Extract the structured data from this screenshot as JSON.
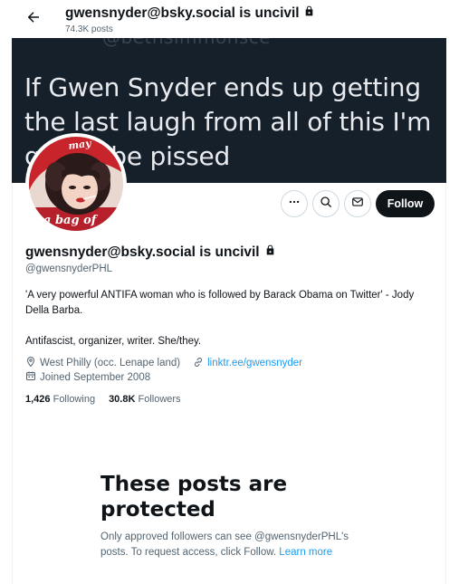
{
  "header": {
    "title": "gwensnyder@bsky.social is uncivil",
    "posts_count": "74.3K posts"
  },
  "banner": {
    "faded_text": "@bethsimmonsce",
    "lines": [
      "If Gwen Snyder ends up getting",
      "the last laugh from all of this I'm",
      "gonna be pissed"
    ]
  },
  "avatar": {
    "top_text": "may",
    "bottom_text": "a bag of"
  },
  "actions": {
    "follow_label": "Follow"
  },
  "profile": {
    "name": "gwensnyder@bsky.social is uncivil",
    "handle": "@gwensnyderPHL",
    "bio_line1": "'A very powerful ANTIFA woman who is followed by Barack Obama on Twitter' - Jody Della Barba.",
    "bio_line2": "Antifascist, organizer, writer. She/they.",
    "location": "West Philly (occ. Lenape land)",
    "website": "linktr.ee/gwensnyder",
    "joined": "Joined September 2008",
    "following_count": "1,426",
    "following_label": "Following",
    "followers_count": "30.8K",
    "followers_label": "Followers"
  },
  "protected": {
    "title": "These posts are protected",
    "text": "Only approved followers can see @gwensnyderPHL's posts. To request access, click Follow.",
    "learn_more": "Learn more"
  },
  "colors": {
    "accent": "#1d9bf0",
    "text": "#0f1419",
    "muted": "#536471",
    "banner": "#15202b"
  },
  "icons": [
    "back-arrow-icon",
    "lock-icon",
    "more-icon",
    "search-icon",
    "message-icon",
    "location-icon",
    "link-icon",
    "calendar-icon"
  ]
}
